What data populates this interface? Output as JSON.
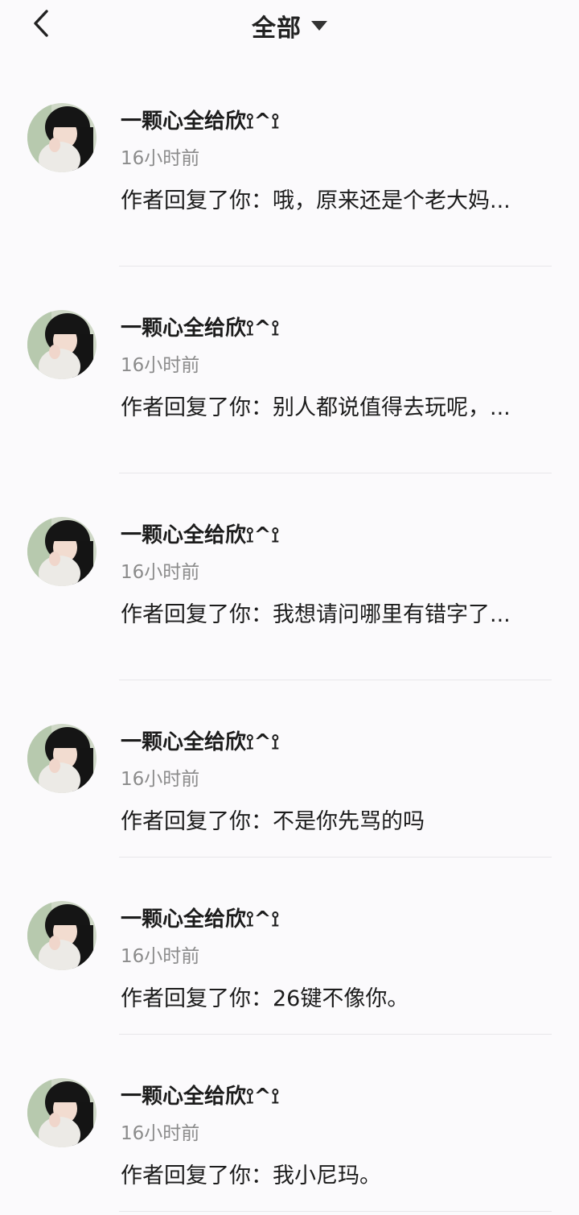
{
  "header": {
    "title": "全部",
    "back_icon": "chevron-left-icon",
    "dropdown_icon": "caret-down-icon"
  },
  "notifications": [
    {
      "username": "一颗心全给欣⟟^⟟",
      "time": "16小时前",
      "content": "作者回复了你：哦，原来还是个老大妈..."
    },
    {
      "username": "一颗心全给欣⟟^⟟",
      "time": "16小时前",
      "content": "作者回复了你：别人都说值得去玩呢，..."
    },
    {
      "username": "一颗心全给欣⟟^⟟",
      "time": "16小时前",
      "content": "作者回复了你：我想请问哪里有错字了..."
    },
    {
      "username": "一颗心全给欣⟟^⟟",
      "time": "16小时前",
      "content": "作者回复了你：不是你先骂的吗"
    },
    {
      "username": "一颗心全给欣⟟^⟟",
      "time": "16小时前",
      "content": "作者回复了你：26键不像你。"
    },
    {
      "username": "一颗心全给欣⟟^⟟",
      "time": "16小时前",
      "content": "作者回复了你：我小尼玛。"
    }
  ]
}
